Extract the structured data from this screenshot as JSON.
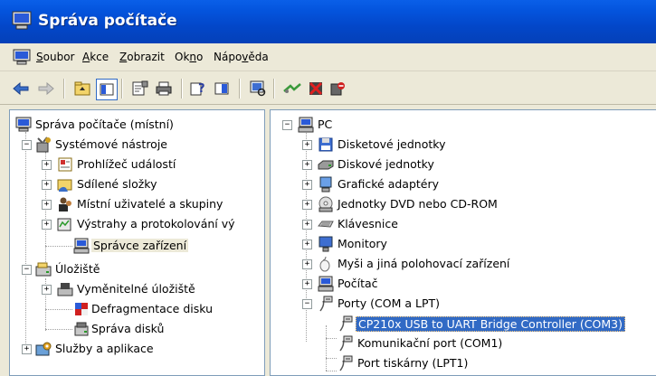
{
  "window": {
    "title": "Správa počítače"
  },
  "menu": [
    {
      "label": "Soubor",
      "u": "S",
      "rest": "oubor"
    },
    {
      "label": "Akce",
      "u": "A",
      "rest": "kce"
    },
    {
      "label": "Zobrazit",
      "u": "Z",
      "rest": "obrazit"
    },
    {
      "label": "Okno",
      "pre": "Ok",
      "u": "n",
      "rest": "o"
    },
    {
      "label": "Nápověda",
      "pre": "Nápo",
      "u": "v",
      "rest": "ěda"
    }
  ],
  "toolbar": {
    "icons": [
      "back-arrow-icon",
      "forward-arrow-icon",
      "up-folder-icon",
      "show-tree-icon",
      "properties-icon",
      "print-icon",
      "help-icon",
      "console-pane-icon",
      "scan-hardware-icon",
      "update-driver-icon",
      "uninstall-icon",
      "disable-device-icon"
    ]
  },
  "left_tree": [
    {
      "label": "Správa počítače (místní)",
      "icon": "computer-management-icon"
    },
    {
      "label": "Systémové nástroje",
      "icon": "system-tools-icon"
    },
    {
      "label": "Prohlížeč událostí",
      "icon": "event-viewer-icon"
    },
    {
      "label": "Sdílené složky",
      "icon": "shared-folders-icon"
    },
    {
      "label": "Místní uživatelé a skupiny",
      "icon": "local-users-icon"
    },
    {
      "label": "Výstrahy a protokolování vý",
      "icon": "alerts-logs-icon"
    },
    {
      "label": "Správce zařízení",
      "icon": "device-manager-icon"
    },
    {
      "label": "Úložiště",
      "icon": "storage-icon"
    },
    {
      "label": "Vyměnitelné úložiště",
      "icon": "removable-storage-icon"
    },
    {
      "label": "Defragmentace disku",
      "icon": "defrag-icon"
    },
    {
      "label": "Správa disků",
      "icon": "disk-management-icon"
    },
    {
      "label": "Služby a aplikace",
      "icon": "services-apps-icon"
    }
  ],
  "right_tree": [
    {
      "label": "PC",
      "icon": "computer-icon"
    },
    {
      "label": "Disketové jednotky",
      "icon": "floppy-icon"
    },
    {
      "label": "Diskové jednotky",
      "icon": "hard-disk-icon"
    },
    {
      "label": "Grafické adaptéry",
      "icon": "display-adapter-icon"
    },
    {
      "label": "Jednotky DVD nebo CD-ROM",
      "icon": "cdrom-icon"
    },
    {
      "label": "Klávesnice",
      "icon": "keyboard-icon"
    },
    {
      "label": "Monitory",
      "icon": "monitor-icon"
    },
    {
      "label": "Myši a jiná polohovací zařízení",
      "icon": "mouse-icon"
    },
    {
      "label": "Počítač",
      "icon": "computer-small-icon"
    },
    {
      "label": "Porty (COM a LPT)",
      "icon": "port-icon"
    },
    {
      "label": "CP210x USB to UART Bridge Controller (COM3)",
      "icon": "port-icon"
    },
    {
      "label": "Komunikační port (COM1)",
      "icon": "port-icon"
    },
    {
      "label": "Port tiskárny (LPT1)",
      "icon": "port-icon"
    }
  ]
}
